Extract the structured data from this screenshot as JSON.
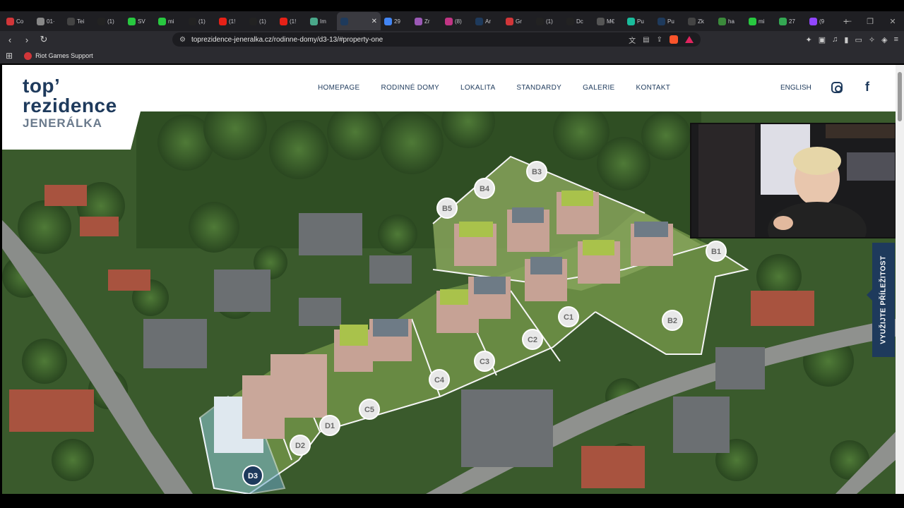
{
  "browser": {
    "tabs": [
      {
        "label": "Co",
        "color": "#d13639"
      },
      {
        "label": "01·",
        "color": "#888888"
      },
      {
        "label": "Tei",
        "color": "#444444"
      },
      {
        "label": "(1)",
        "color": "#222222"
      },
      {
        "label": "SV",
        "color": "#28c840"
      },
      {
        "label": "mi",
        "color": "#28c840"
      },
      {
        "label": "(1)",
        "color": "#222222"
      },
      {
        "label": "(1!",
        "color": "#e62117"
      },
      {
        "label": "(1)",
        "color": "#222222"
      },
      {
        "label": "(1!",
        "color": "#e62117"
      },
      {
        "label": "Im",
        "color": "#4aa88a"
      },
      {
        "label": "",
        "color": "#1e3a5c",
        "active": true
      },
      {
        "label": "29",
        "color": "#4285f4"
      },
      {
        "label": "Zr",
        "color": "#9b59b6"
      },
      {
        "label": "(8)",
        "color": "#c13584"
      },
      {
        "label": "Ar",
        "color": "#1e3a5c"
      },
      {
        "label": "Gr",
        "color": "#d13639"
      },
      {
        "label": "(1)",
        "color": "#222222"
      },
      {
        "label": "Dc",
        "color": "#222222"
      },
      {
        "label": "M€",
        "color": "#555555"
      },
      {
        "label": "Pu",
        "color": "#1abc9c"
      },
      {
        "label": "Pu",
        "color": "#1e3a5c"
      },
      {
        "label": "Zk",
        "color": "#444444"
      },
      {
        "label": "ha",
        "color": "#3b8a3b"
      },
      {
        "label": "mi",
        "color": "#28c840"
      },
      {
        "label": "27",
        "color": "#34a853"
      },
      {
        "label": "(9",
        "color": "#9146ff"
      }
    ],
    "new_tab": "+",
    "url": "toprezidence-jeneralka.cz/rodinne-domy/d3-13/#property-one",
    "bookmark": "Riot Games Support"
  },
  "site": {
    "logo": {
      "line1": "top’",
      "line2": "rezidence",
      "line3": "JENERÁLKA"
    },
    "nav": [
      "HOMEPAGE",
      "RODINNÉ DOMY",
      "LOKALITA",
      "STANDARDY",
      "GALERIE",
      "KONTAKT"
    ],
    "language": "ENGLISH",
    "side_tab": "VYUŽIJTE PŘÍLEŽITOST",
    "plots": [
      {
        "id": "B3",
        "active": false
      },
      {
        "id": "B4",
        "active": false
      },
      {
        "id": "B5",
        "active": false
      },
      {
        "id": "B1",
        "active": false
      },
      {
        "id": "B2",
        "active": false
      },
      {
        "id": "C1",
        "active": false
      },
      {
        "id": "C2",
        "active": false
      },
      {
        "id": "C3",
        "active": false
      },
      {
        "id": "C4",
        "active": false
      },
      {
        "id": "C5",
        "active": false
      },
      {
        "id": "D1",
        "active": false
      },
      {
        "id": "D2",
        "active": false
      },
      {
        "id": "D3",
        "active": true
      }
    ]
  },
  "colors": {
    "brand": "#1e3a5c",
    "marker_fill": "#e8e8e8",
    "active_marker": "#1e3a5c"
  }
}
